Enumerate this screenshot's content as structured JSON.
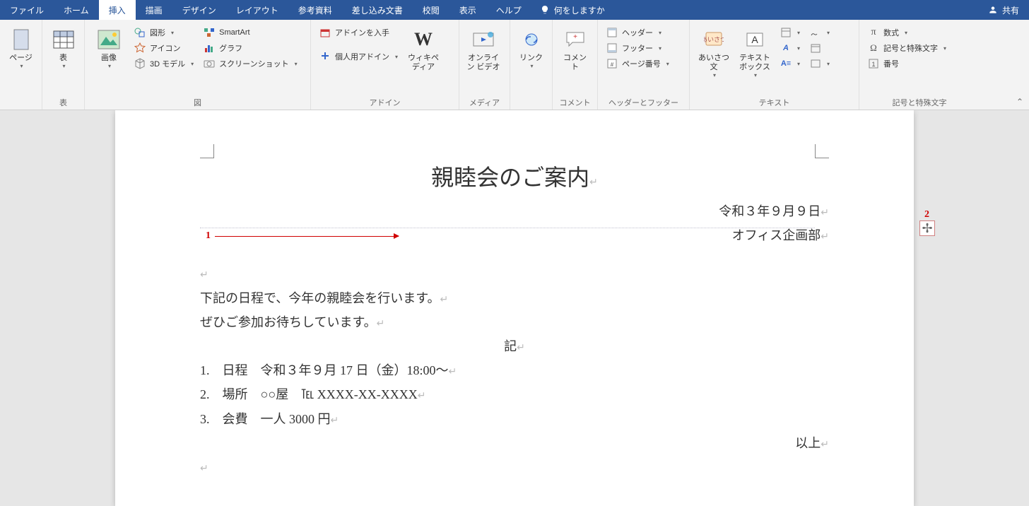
{
  "menu": {
    "tabs": [
      "ファイル",
      "ホーム",
      "挿入",
      "描画",
      "デザイン",
      "レイアウト",
      "参考資料",
      "差し込み文書",
      "校閲",
      "表示",
      "ヘルプ"
    ],
    "active_index": 2,
    "tellme_icon": "lightbulb-icon",
    "tellme_text": "何をしますか",
    "share_icon": "share-icon",
    "share_text": "共有"
  },
  "ribbon": {
    "pages": {
      "page_label": "ページ",
      "group_label": ""
    },
    "tables": {
      "table_label": "表",
      "group_label": "表"
    },
    "illust": {
      "image_label": "画像",
      "shapes": "図形",
      "icons": "アイコン",
      "model3d": "3D モデル",
      "smartart": "SmartArt",
      "chart": "グラフ",
      "screenshot": "スクリーンショット",
      "group_label": "図"
    },
    "addins": {
      "get": "アドインを入手",
      "my": "個人用アドイン",
      "wiki": "ウィキペディア",
      "group_label": "アドイン"
    },
    "media": {
      "video": "オンライン ビデオ",
      "group_label": "メディア"
    },
    "links": {
      "link": "リンク",
      "group_label": ""
    },
    "comments": {
      "comment": "コメント",
      "group_label": "コメント"
    },
    "headerfooter": {
      "header": "ヘッダー",
      "footer": "フッター",
      "pagenum": "ページ番号",
      "group_label": "ヘッダーとフッター"
    },
    "text": {
      "greeting": "あいさつ文",
      "textbox": "テキスト\nボックス",
      "group_label": "テキスト"
    },
    "symbols": {
      "equation": "数式",
      "symbol": "記号と特殊文字",
      "number": "番号",
      "group_label": "記号と特殊文字"
    }
  },
  "doc": {
    "title": "親睦会のご案内",
    "date": "令和３年９月９日",
    "dept": "オフィス企画部",
    "para1": "下記の日程で、今年の親睦会を行います。",
    "para2": "ぜひご参加お待ちしています。",
    "ki": "記",
    "item1": "1.　日程　令和３年９月 17 日（金）18:00～",
    "item2": "2.　場所　○○屋　℡ XXXX-XX-XXXX",
    "item3": "3.　会費　一人 3000 円",
    "ijou": "以上",
    "ret": "↵"
  },
  "annot": {
    "a1": "1",
    "a2": "2",
    "plus": "✢"
  }
}
